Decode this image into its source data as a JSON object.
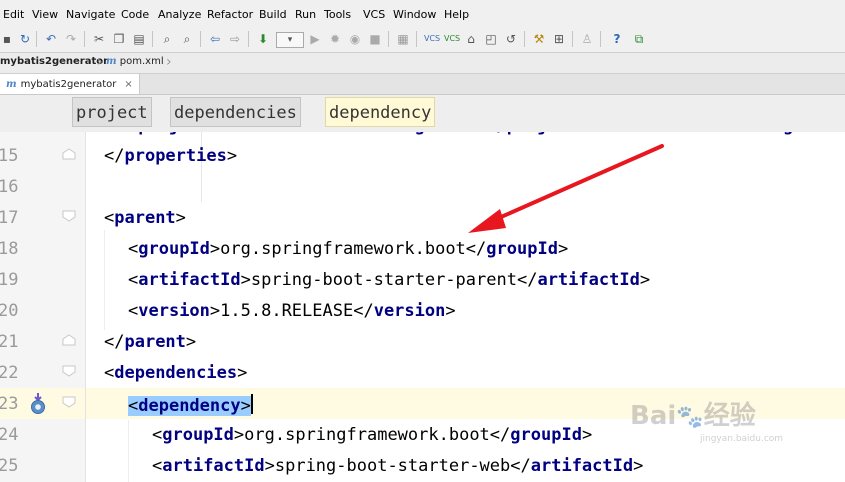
{
  "menu": [
    "Edit",
    "View",
    "Navigate",
    "Code",
    "Analyze",
    "Refactor",
    "Build",
    "Run",
    "Tools",
    "VCS",
    "Window",
    "Help"
  ],
  "navbar": {
    "project": "mybatis2generator",
    "file": "pom.xml"
  },
  "tab": {
    "label": "mybatis2generator",
    "close": "×"
  },
  "breadcrumbs": [
    "project",
    "dependencies",
    "dependency"
  ],
  "editor": {
    "lines": [
      {
        "num": "15",
        "open": "</",
        "tag": "properties",
        "close": ">"
      },
      {
        "num": "16"
      },
      {
        "num": "17",
        "open": "<",
        "tag": "parent",
        "close": ">"
      },
      {
        "num": "18",
        "open": "<",
        "tag": "groupId",
        "close": ">",
        "text": "org.springframework.boot",
        "open2": "</",
        "tag2": "groupId",
        "close2": ">"
      },
      {
        "num": "19",
        "open": "<",
        "tag": "artifactId",
        "close": ">",
        "text": "spring-boot-starter-parent",
        "open2": "</",
        "tag2": "artifactId",
        "close2": ">"
      },
      {
        "num": "20",
        "open": "<",
        "tag": "version",
        "close": ">",
        "text": "1.5.8.RELEASE",
        "open2": "</",
        "tag2": "version",
        "close2": ">"
      },
      {
        "num": "21",
        "open": "</",
        "tag": "parent",
        "close": ">"
      },
      {
        "num": "22",
        "open": "<",
        "tag": "dependencies",
        "close": ">"
      },
      {
        "num": "23",
        "open": "<",
        "tag": "dependency",
        "close": ">"
      },
      {
        "num": "24",
        "open": "<",
        "tag": "groupId",
        "close": ">",
        "text": "org.springframework.boot",
        "open2": "</",
        "tag2": "groupId",
        "close2": ">"
      },
      {
        "num": "25",
        "open": "<",
        "tag": "artifactId",
        "close": ">",
        "text": "spring-boot-starter-web",
        "open2": "</",
        "tag2": "artifactId",
        "close2": ">"
      }
    ]
  },
  "watermark": {
    "brand": "Bai",
    "brand2": "经验",
    "url": "jingyan.baidu.com"
  },
  "colors": {
    "tag": "#000080",
    "current_line": "#fffae2",
    "highlight": "#99ccff",
    "arrow": "#e8161e",
    "project_icon": "#4f86c6"
  },
  "icons": {
    "gutter_run": "maven-run-icon",
    "arrow": "red-arrow-annotation"
  }
}
